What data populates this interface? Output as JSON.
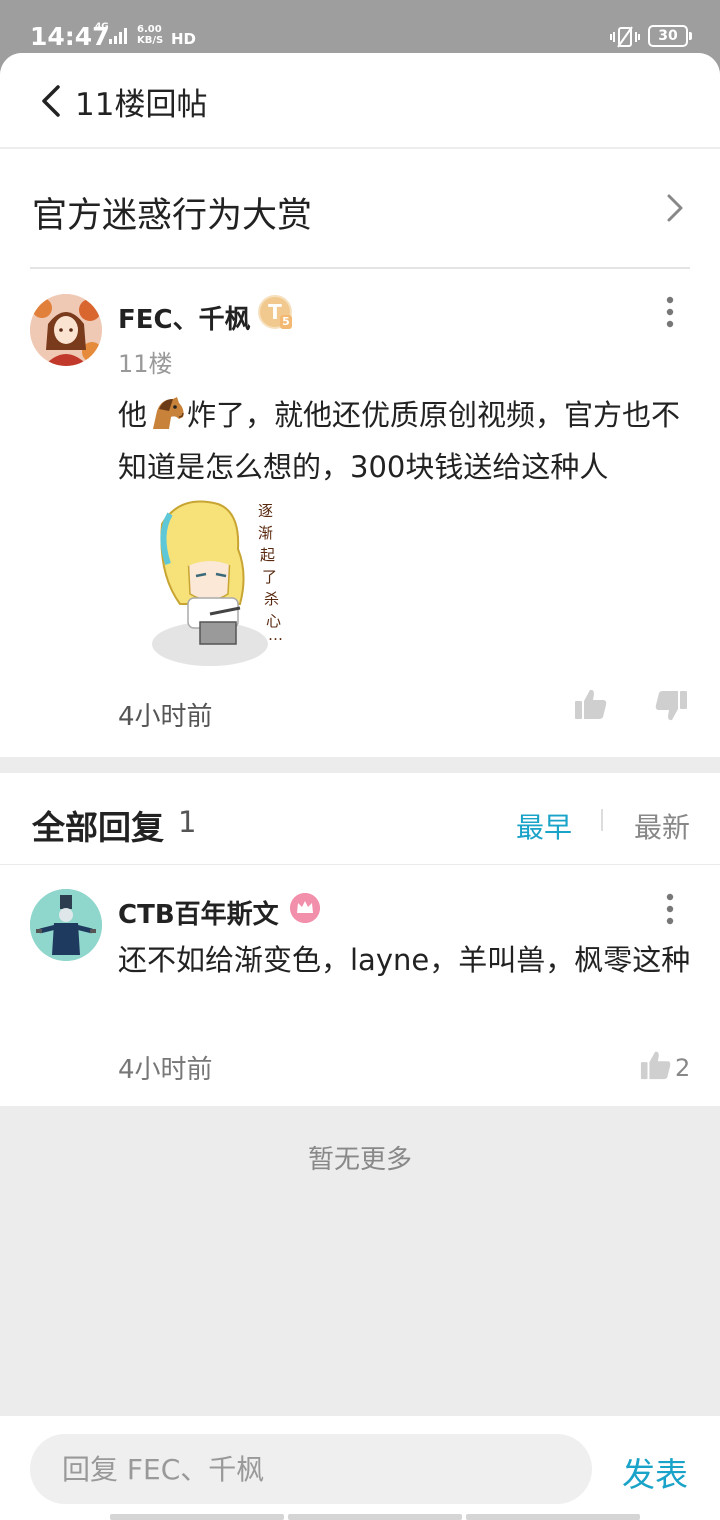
{
  "status_bar": {
    "time": "14:47",
    "network_type": "4G",
    "speed_value": "6.00",
    "speed_unit": "KB/S",
    "hd": "HD",
    "battery": "30"
  },
  "header": {
    "back_icon": "chevron-left-icon",
    "title": "11楼回帖"
  },
  "thread": {
    "title": "官方迷惑行为大赏"
  },
  "post": {
    "author": "FEC、千枫",
    "badge_letter": "T",
    "badge_level": "5",
    "floor": "11楼",
    "content_before": "他",
    "content_after": "炸了，就他还优质原创视频，官方也不知道是怎么想的，300块钱送给这种人",
    "time": "4小时前"
  },
  "replies": {
    "title": "全部回复",
    "count": "1",
    "sort_earliest": "最早",
    "sort_newest": "最新",
    "items": [
      {
        "author": "CTB百年斯文",
        "content": "还不如给渐变色，layne，羊叫兽，枫零这种",
        "time": "4小时前",
        "likes": "2"
      }
    ],
    "no_more": "暂无更多"
  },
  "reply_box": {
    "placeholder": "回复 FEC、千枫",
    "submit": "发表"
  },
  "colors": {
    "accent": "#1aa3c8",
    "status_bar": "#9e9e9e"
  }
}
